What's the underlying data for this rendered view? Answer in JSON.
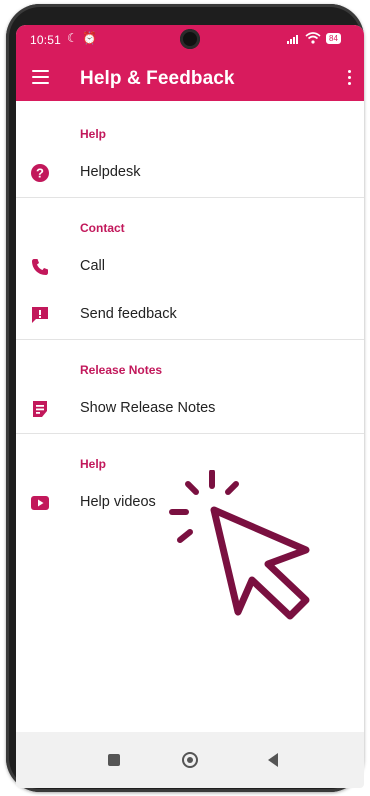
{
  "status_bar": {
    "time": "10:51",
    "battery": "84"
  },
  "app_bar": {
    "title": "Help & Feedback"
  },
  "sections": [
    {
      "header": "Help",
      "items": [
        {
          "label": "Helpdesk",
          "icon": "help-circle-icon"
        }
      ]
    },
    {
      "header": "Contact",
      "items": [
        {
          "label": "Call",
          "icon": "phone-icon"
        },
        {
          "label": "Send feedback",
          "icon": "feedback-icon"
        }
      ]
    },
    {
      "header": "Release Notes",
      "items": [
        {
          "label": "Show Release Notes",
          "icon": "release-notes-icon"
        }
      ]
    },
    {
      "header": "Help",
      "items": [
        {
          "label": "Help videos",
          "icon": "video-icon"
        }
      ]
    }
  ],
  "colors": {
    "primary": "#d81b5d",
    "accent": "#c2185b",
    "cursor": "#7a1040"
  }
}
